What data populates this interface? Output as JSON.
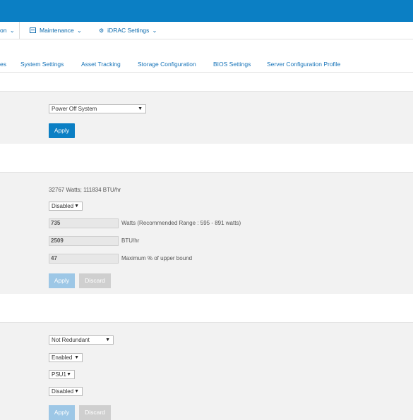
{
  "menubar": {
    "partial_label": "on",
    "maintenance_label": "Maintenance",
    "idrac_label": "iDRAC Settings"
  },
  "tabs": [
    {
      "label": "es"
    },
    {
      "label": "System Settings"
    },
    {
      "label": "Asset Tracking"
    },
    {
      "label": "Storage Configuration"
    },
    {
      "label": "BIOS Settings"
    },
    {
      "label": "Server Configuration Profile"
    }
  ],
  "power_action": {
    "select_value": "Power Off System",
    "apply_label": "Apply"
  },
  "power_cap": {
    "max_power_text": "32767 Watts; 111834 BTU/hr",
    "enable_value": "Disabled",
    "watts_value": "735",
    "watts_hint": "Watts (Recommended Range : 595 - 891 watts)",
    "btu_value": "2509",
    "btu_unit": "BTU/hr",
    "percent_value": "47",
    "percent_hint": "Maximum % of upper bound",
    "apply_label": "Apply",
    "discard_label": "Discard"
  },
  "redundancy": {
    "policy_value": "Not Redundant",
    "hot_spare_value": "Enabled",
    "primary_psu_value": "PSU1",
    "pfc_value": "Disabled",
    "apply_label": "Apply",
    "discard_label": "Discard"
  },
  "colors": {
    "brand_blue": "#0b7fc4",
    "link_blue": "#1673b8",
    "disabled_blue": "#9dc7e6",
    "disabled_grey": "#cfcfcf"
  }
}
